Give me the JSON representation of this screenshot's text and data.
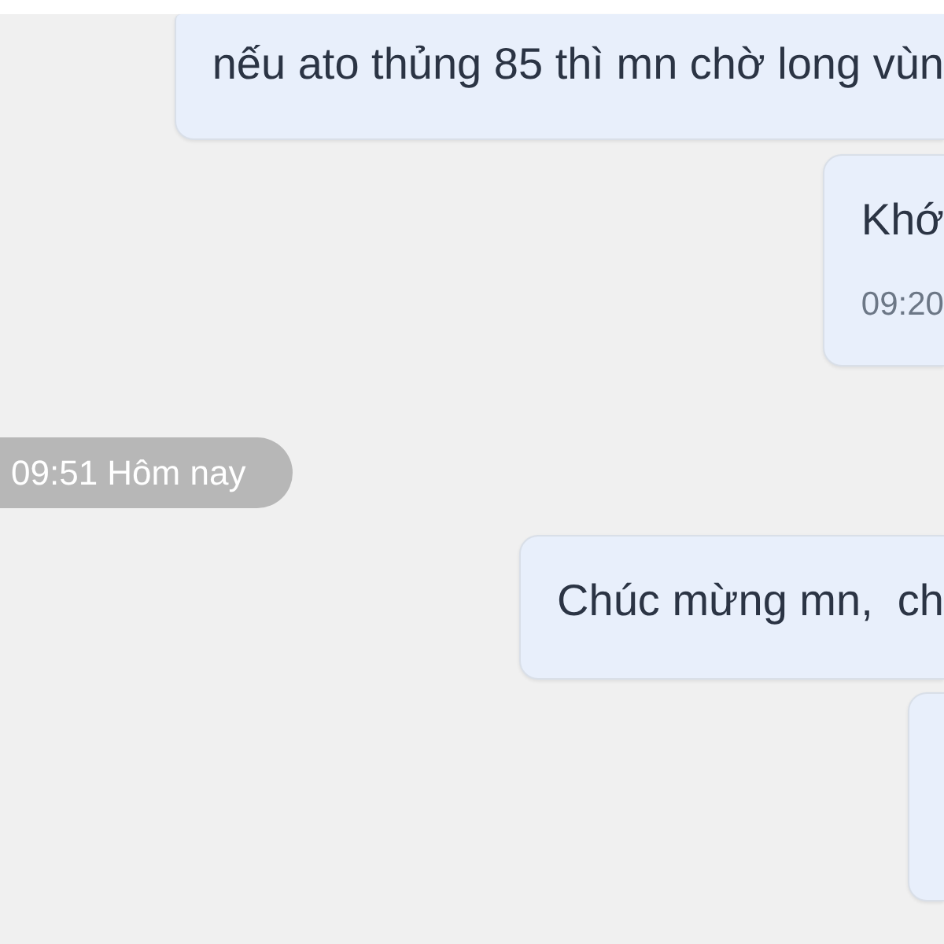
{
  "messages": [
    {
      "kind": "bubble",
      "text": "nếu ato thủng 85 thì mn chờ long vùn"
    },
    {
      "kind": "bubble",
      "text": "Khớ",
      "time": "09:20"
    },
    {
      "kind": "date",
      "text": "09:51 Hôm nay"
    },
    {
      "kind": "bubble",
      "text": "Chúc mừng mn,  ch"
    },
    {
      "kind": "bubble"
    }
  ]
}
